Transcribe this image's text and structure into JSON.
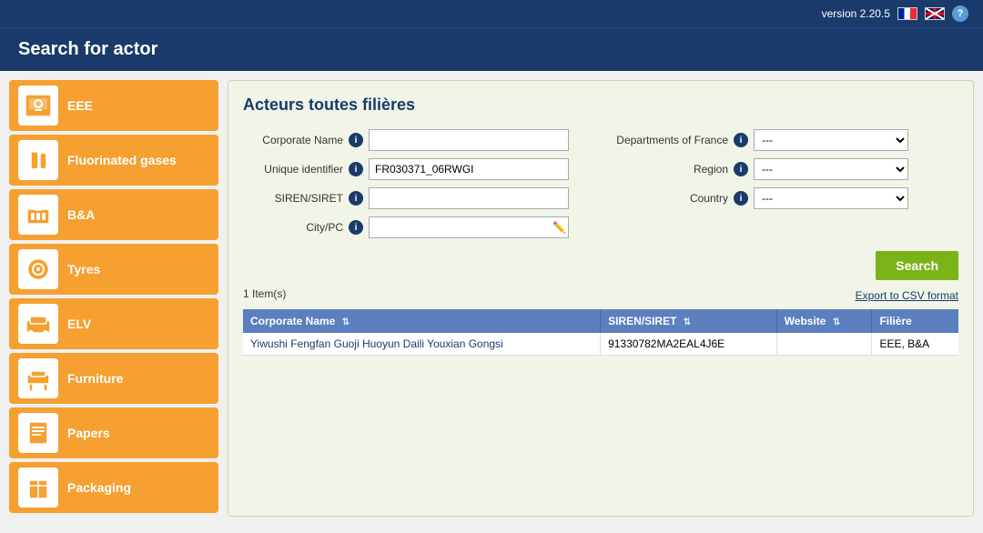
{
  "topbar": {
    "version": "version 2.20.5",
    "help_label": "?"
  },
  "header": {
    "title": "Search for actor"
  },
  "sidebar": {
    "items": [
      {
        "id": "eee",
        "label": "EEE",
        "icon": "washing-machine"
      },
      {
        "id": "fluorinated-gases",
        "label": "Fluorinated gases",
        "icon": "gas-cylinder"
      },
      {
        "id": "ba",
        "label": "B&A",
        "icon": "battery"
      },
      {
        "id": "tyres",
        "label": "Tyres",
        "icon": "tyre"
      },
      {
        "id": "elv",
        "label": "ELV",
        "icon": "car-seat"
      },
      {
        "id": "furniture",
        "label": "Furniture",
        "icon": "furniture"
      },
      {
        "id": "papers",
        "label": "Papers",
        "icon": "papers"
      },
      {
        "id": "packaging",
        "label": "Packaging",
        "icon": "packaging"
      }
    ]
  },
  "content": {
    "title": "Acteurs toutes filières",
    "form": {
      "corporate_name_label": "Corporate Name",
      "corporate_name_value": "",
      "corporate_name_placeholder": "",
      "unique_identifier_label": "Unique identifier",
      "unique_identifier_value": "FR030371_06RWGI",
      "siren_siret_label": "SIREN/SIRET",
      "siren_siret_value": "",
      "city_pc_label": "City/PC",
      "city_pc_value": "",
      "departments_label": "Departments of France",
      "departments_value": "---",
      "region_label": "Region",
      "region_value": "---",
      "country_label": "Country",
      "country_value": "---"
    },
    "search_button": "Search",
    "export_link": "Export to CSV format",
    "items_count": "1 Item(s)",
    "table": {
      "headers": [
        {
          "label": "Corporate Name",
          "sortable": true
        },
        {
          "label": "SIREN/SIRET",
          "sortable": true
        },
        {
          "label": "Website",
          "sortable": true
        },
        {
          "label": "Filière",
          "sortable": false
        }
      ],
      "rows": [
        {
          "corporate_name": "Yiwushi Fengfan Guoji Huoyun Daili Youxian Gongsi",
          "siren_siret": "91330782MA2EAL4J6E",
          "website": "",
          "filiere": "EEE, B&A"
        }
      ]
    }
  }
}
